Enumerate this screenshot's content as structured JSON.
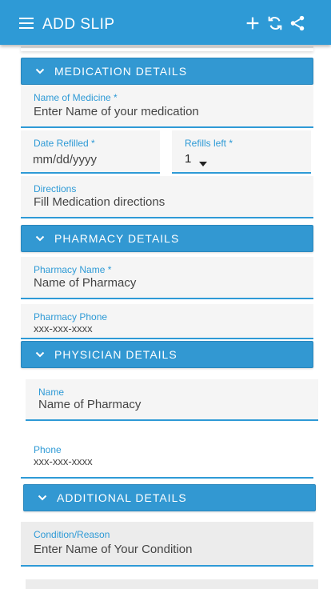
{
  "appbar": {
    "title": "ADD SLIP",
    "icons": [
      "menu-icon",
      "add-icon",
      "sync-icon",
      "share-icon"
    ],
    "color": "#2e9ad6"
  },
  "sections": {
    "medication": "MEDICATION DETAILS",
    "pharmacy": "PHARMACY DETAILS",
    "physician": "PHYSICIAN DETAILS",
    "additional": "ADDITIONAL DETAILS"
  },
  "fields": {
    "medicine_name": {
      "label": "Name of Medicine *",
      "placeholder": "Enter Name of your medication"
    },
    "date_refilled": {
      "label": "Date Refilled *",
      "placeholder": "mm/dd/yyyy"
    },
    "refills_left": {
      "label": "Refills left *",
      "value": "1"
    },
    "directions": {
      "label": "Directions",
      "placeholder": "Fill Medication directions"
    },
    "pharmacy_name": {
      "label": "Pharmacy Name *",
      "placeholder": "Name of Pharmacy"
    },
    "pharmacy_phone": {
      "label": "Pharmacy Phone",
      "placeholder": "xxx-xxx-xxxx"
    },
    "physician_name": {
      "label": "Name",
      "placeholder": "Name of Pharmacy"
    },
    "physician_phone": {
      "label": "Phone",
      "placeholder": "xxx-xxx-xxxx"
    },
    "condition": {
      "label": "Condition/Reason",
      "placeholder": "Enter Name of Your Condition"
    }
  },
  "colors": {
    "accent": "#2e9ad6",
    "section_header": "#3298d2"
  }
}
